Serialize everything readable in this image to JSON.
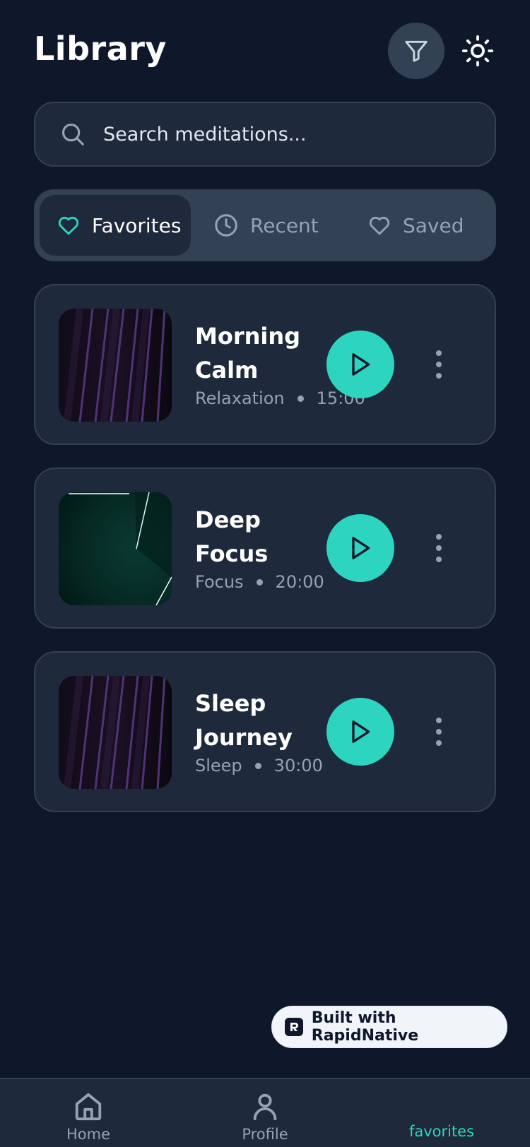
{
  "header": {
    "title": "Library",
    "filter_icon": "filter-icon",
    "theme_icon": "sun-icon"
  },
  "search": {
    "placeholder": "Search meditations...",
    "value": "",
    "icon": "search-icon"
  },
  "tabs": [
    {
      "label": "Favorites",
      "icon": "heart-icon",
      "active": true
    },
    {
      "label": "Recent",
      "icon": "clock-icon",
      "active": false
    },
    {
      "label": "Saved",
      "icon": "heart-icon",
      "active": false
    }
  ],
  "items": [
    {
      "title": "Morning Calm",
      "category": "Relaxation",
      "duration": "15:00"
    },
    {
      "title": "Deep Focus",
      "category": "Focus",
      "duration": "20:00"
    },
    {
      "title": "Sleep Journey",
      "category": "Sleep",
      "duration": "30:00"
    }
  ],
  "badge": {
    "label": "Built with RapidNative"
  },
  "nav": [
    {
      "label": "Home",
      "icon": "home-icon"
    },
    {
      "label": "Profile",
      "icon": "user-icon"
    },
    {
      "label": "favorites",
      "active": true
    }
  ],
  "colors": {
    "background": "#0f172a",
    "card": "#1e293b",
    "border": "#334155",
    "accent": "#2dd4bf",
    "muted": "#94a3b8"
  }
}
